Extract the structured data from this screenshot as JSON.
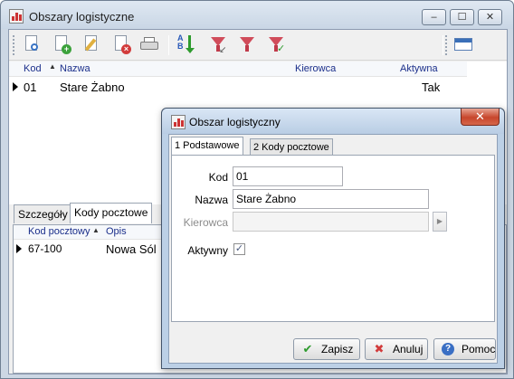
{
  "window": {
    "title": "Obszary logistyczne",
    "buttons": {
      "minimize": "‒",
      "maximize": "☐",
      "close": "✕"
    }
  },
  "toolbar": {
    "icons": [
      "preview-icon",
      "add-icon",
      "edit-icon",
      "delete-icon",
      "print-icon",
      "sort-icon",
      "filter-icon",
      "filter-clear-icon",
      "filter-apply-icon",
      "layout-icon"
    ]
  },
  "grid": {
    "columns": [
      "Kod",
      "Nazwa",
      "Kierowca",
      "Aktywna"
    ],
    "rows": [
      {
        "kod": "01",
        "nazwa": "Stare Żabno",
        "kierowca": "",
        "aktywna": "Tak"
      }
    ]
  },
  "bottom_tabs": {
    "tabs": [
      "Szczegóły",
      "Kody pocztowe"
    ],
    "active": "Kody pocztowe",
    "columns": [
      "Kod pocztowy",
      "Opis"
    ],
    "rows": [
      {
        "kod": "67-100",
        "opis": "Nowa Sól"
      }
    ]
  },
  "dialog": {
    "title": "Obszar logistyczny",
    "close": "✕",
    "tabs": [
      "1 Podstawowe",
      "2 Kody pocztowe"
    ],
    "fields": {
      "kod_label": "Kod",
      "kod_value": "01",
      "nazwa_label": "Nazwa",
      "nazwa_value": "Stare Żabno",
      "kierowca_label": "Kierowca",
      "kierowca_value": "",
      "aktywny_label": "Aktywny",
      "aktywny_checked": true
    },
    "buttons": {
      "save": "Zapisz",
      "cancel": "Anuluj",
      "help": "Pomoc"
    }
  },
  "colors": {
    "header_text": "#1a2e8a",
    "close_red": "#c7462c",
    "accent_green": "#2e9b2e"
  }
}
